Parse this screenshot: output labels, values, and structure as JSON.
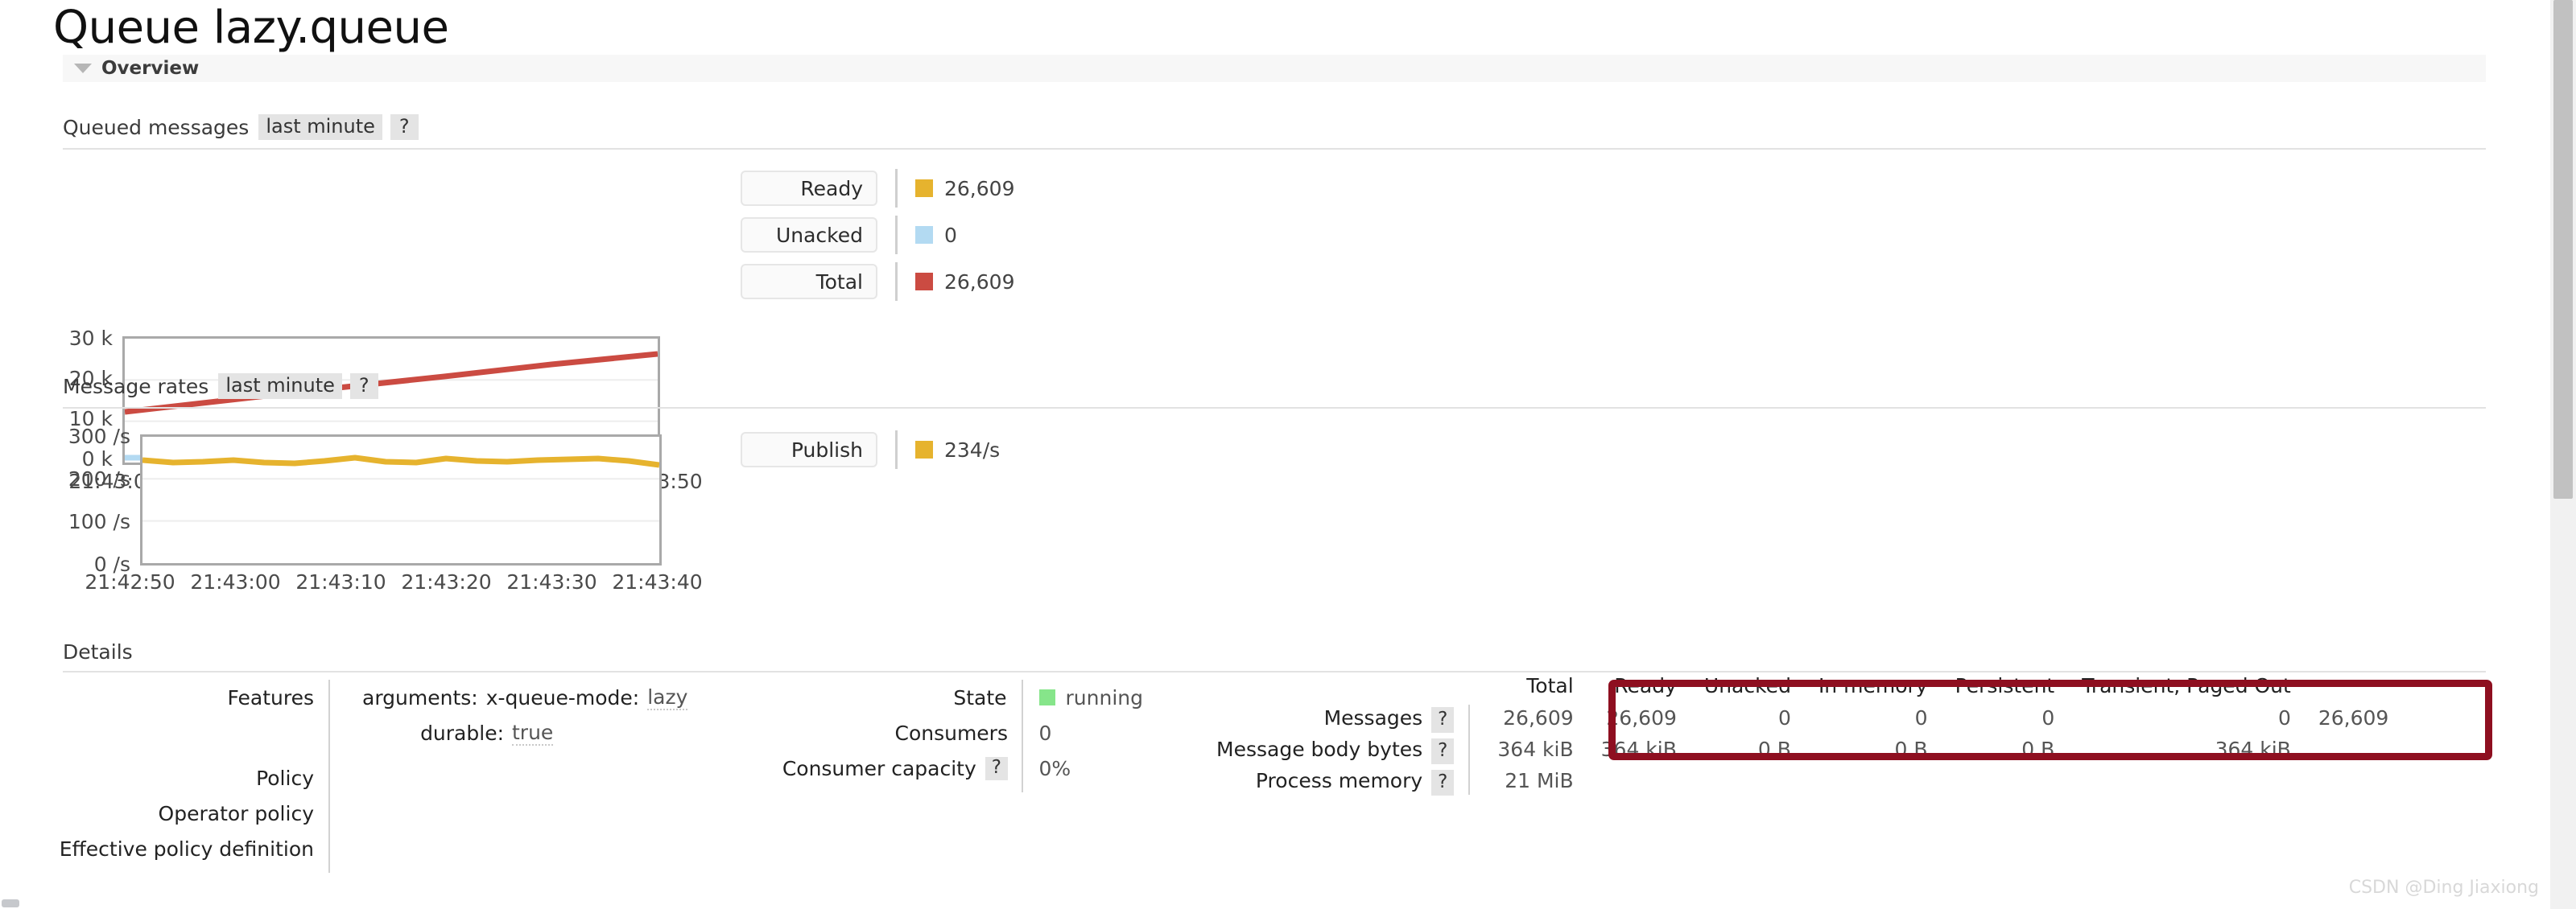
{
  "page": {
    "title": "Queue lazy.queue",
    "section_label": "Overview",
    "details_label": "Details",
    "watermark": "CSDN @Ding Jiaxiong"
  },
  "queued_messages": {
    "title": "Queued messages",
    "period_chip": "last minute",
    "help_chip": "?",
    "legend": [
      {
        "label": "Ready",
        "value": "26,609",
        "color": "#e6b32e"
      },
      {
        "label": "Unacked",
        "value": "0",
        "color": "#b3daf2"
      },
      {
        "label": "Total",
        "value": "26,609",
        "color": "#cb4b42"
      }
    ]
  },
  "message_rates": {
    "title": "Message rates",
    "period_chip": "last minute",
    "help_chip": "?",
    "legend": [
      {
        "label": "Publish",
        "value": "234/s",
        "color": "#e6b32e"
      }
    ]
  },
  "chart_data": [
    {
      "type": "line",
      "title": "Queued messages",
      "subtitle": "last minute",
      "xlabel": "",
      "ylabel": "",
      "ylim": [
        0,
        30000
      ],
      "yticks": [
        0,
        10000,
        20000,
        30000
      ],
      "ytick_labels": [
        "0 k",
        "10 k",
        "20 k",
        "30 k"
      ],
      "grid": true,
      "legend_position": "right",
      "x": [
        "21:43:00",
        "21:43:10",
        "21:43:20",
        "21:43:30",
        "21:43:40",
        "21:43:50"
      ],
      "series": [
        {
          "name": "Total",
          "color": "#cb4b42",
          "values": [
            12100,
            15000,
            17900,
            20700,
            23600,
            26609
          ]
        },
        {
          "name": "Ready",
          "color": "#e6b32e",
          "values": [
            12100,
            15000,
            17900,
            20700,
            23600,
            26609
          ]
        },
        {
          "name": "Unacked",
          "color": "#b3daf2",
          "values": [
            0,
            0,
            0,
            0,
            0,
            0
          ]
        }
      ]
    },
    {
      "type": "line",
      "title": "Message rates",
      "subtitle": "last minute",
      "xlabel": "",
      "ylabel": "",
      "ylim": [
        0,
        300
      ],
      "yticks": [
        0,
        100,
        200,
        300
      ],
      "ytick_labels": [
        "0 /s",
        "100 /s",
        "200 /s",
        "300 /s"
      ],
      "grid": true,
      "legend_position": "right",
      "x": [
        "21:42:50",
        "21:43:00",
        "21:43:10",
        "21:43:20",
        "21:43:30",
        "21:43:40"
      ],
      "series": [
        {
          "name": "Publish",
          "color": "#e6b32e",
          "values": [
            243,
            239,
            240,
            242,
            239,
            238,
            241,
            245,
            240,
            239,
            244,
            241,
            240,
            242,
            243,
            244,
            241,
            234
          ]
        }
      ]
    }
  ],
  "details": {
    "features": {
      "key": "Features",
      "args_label": "arguments:",
      "arg_name": "x-queue-mode:",
      "arg_value": "lazy",
      "durable_label": "durable:",
      "durable_value": "true"
    },
    "policy_key": "Policy",
    "operator_policy_key": "Operator policy",
    "effective_policy_key": "Effective policy definition",
    "state": {
      "key": "State",
      "value": "running",
      "color": "#86e58a"
    },
    "consumers": {
      "key": "Consumers",
      "value": "0"
    },
    "consumer_capacity": {
      "key": "Consumer capacity",
      "help": "?",
      "value": "0%"
    }
  },
  "stats": {
    "row_headers": [
      {
        "label": "Messages",
        "help": "?"
      },
      {
        "label": "Message body bytes",
        "help": "?"
      },
      {
        "label": "Process memory",
        "help": "?"
      }
    ],
    "columns": [
      "Total",
      "Ready",
      "Unacked",
      "In memory",
      "Persistent",
      "Transient, Paged Out",
      ""
    ],
    "rows": [
      {
        "name": "Messages",
        "cells": [
          "26,609",
          "26,609",
          "0",
          "0",
          "0",
          "0",
          "26,609"
        ]
      },
      {
        "name": "Message body bytes",
        "cells": [
          "364 kiB",
          "364 kiB",
          "0 B",
          "0 B",
          "0 B",
          "364 kiB",
          ""
        ]
      },
      {
        "name": "Process memory",
        "cells": [
          "21 MiB",
          "",
          "",
          "",
          "",
          "",
          ""
        ]
      }
    ]
  }
}
